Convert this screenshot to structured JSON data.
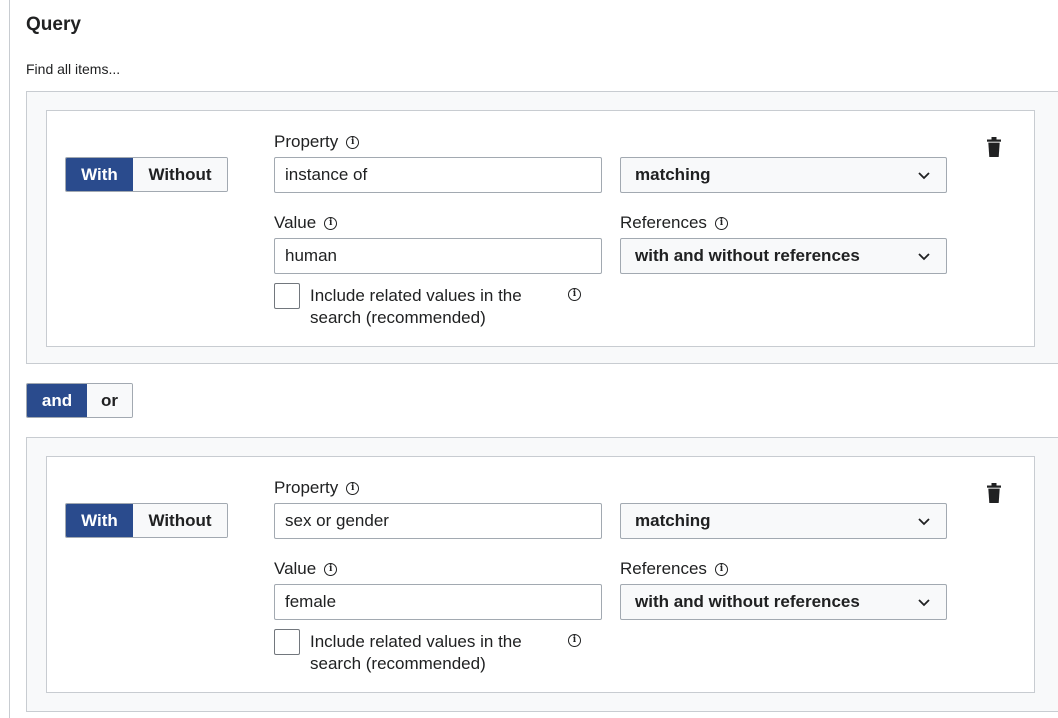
{
  "title": "Query",
  "subtitle": "Find all items...",
  "conditions": [
    {
      "toggle": {
        "with": "With",
        "without": "Without",
        "active": "with"
      },
      "property_label": "Property",
      "property_value": "instance of",
      "matching_select": "matching",
      "value_label": "Value",
      "value_value": "human",
      "references_label": "References",
      "references_select": "with and without references",
      "include_related_label": "Include related values in the search (recommended)"
    },
    {
      "toggle": {
        "with": "With",
        "without": "Without",
        "active": "with"
      },
      "property_label": "Property",
      "property_value": "sex or gender",
      "matching_select": "matching",
      "value_label": "Value",
      "value_value": "female",
      "references_label": "References",
      "references_select": "with and without references",
      "include_related_label": "Include related values in the search (recommended)"
    }
  ],
  "conjunction": {
    "and": "and",
    "or": "or",
    "active": "and"
  },
  "icons": {
    "info": "info-icon",
    "delete": "trash-icon",
    "dropdown": "chevron-down-icon"
  },
  "colors": {
    "accent": "#2a4b8d",
    "border": "#a2a9b1",
    "panel_bg": "#f8f9fa"
  }
}
